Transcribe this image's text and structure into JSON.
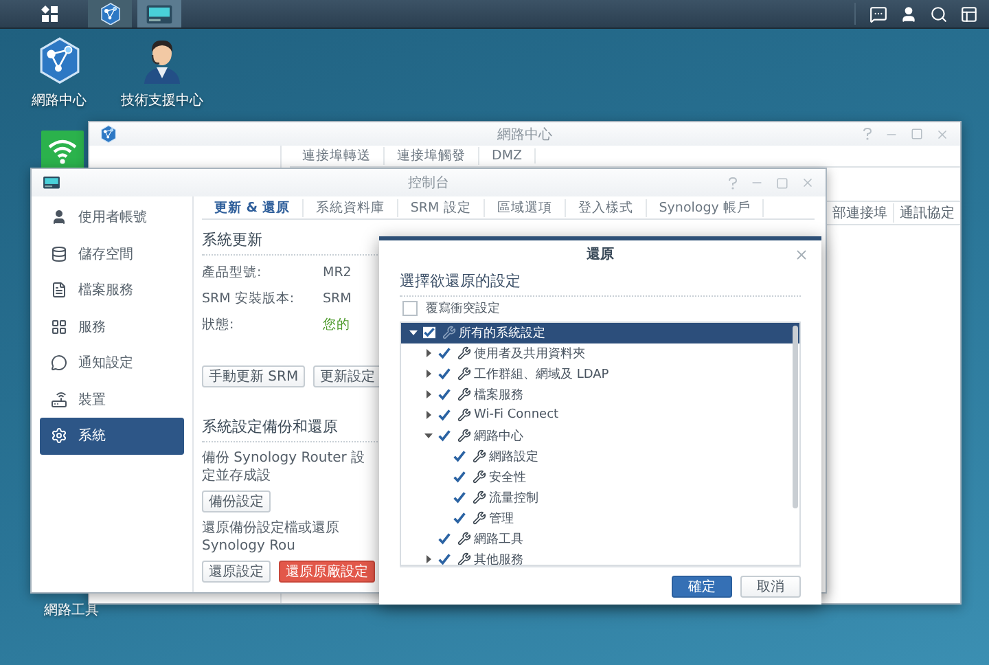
{
  "taskbar": {
    "apps": [
      {
        "kind": "network-center",
        "focused": false
      },
      {
        "kind": "control-panel",
        "focused": true
      }
    ]
  },
  "desktop": {
    "icons": [
      {
        "label": "網路中心",
        "kind": "network"
      },
      {
        "label": "技術支援中心",
        "kind": "support"
      }
    ],
    "bottom_label": "網路工具"
  },
  "network_window": {
    "title": "網路中心",
    "tabs": [
      "連接埠轉送",
      "連接埠觸發",
      "DMZ"
    ],
    "columns": [
      "部連接埠",
      "通訊協定"
    ]
  },
  "control_panel": {
    "title": "控制台",
    "sidebar": [
      {
        "label": "使用者帳號",
        "kind": "user",
        "selected": false
      },
      {
        "label": "儲存空間",
        "kind": "storage",
        "selected": false
      },
      {
        "label": "檔案服務",
        "kind": "file",
        "selected": false
      },
      {
        "label": "服務",
        "kind": "services",
        "selected": false
      },
      {
        "label": "通知設定",
        "kind": "notify",
        "selected": false
      },
      {
        "label": "裝置",
        "kind": "device",
        "selected": false
      },
      {
        "label": "系統",
        "kind": "system",
        "selected": true
      }
    ],
    "tabs": [
      {
        "label": "更新 & 還原",
        "selected": true
      },
      {
        "label": "系統資料庫",
        "selected": false
      },
      {
        "label": "SRM 設定",
        "selected": false
      },
      {
        "label": "區域選項",
        "selected": false
      },
      {
        "label": "登入樣式",
        "selected": false
      },
      {
        "label": "Synology 帳戶",
        "selected": false
      }
    ],
    "update": {
      "heading": "系統更新",
      "rows": [
        {
          "label": "產品型號:",
          "value": "MR2",
          "kind": "plain"
        },
        {
          "label": "SRM 安裝版本:",
          "value": "SRM",
          "kind": "plain"
        },
        {
          "label": "狀態:",
          "value": "您的",
          "kind": "ok"
        }
      ],
      "buttons": [
        "手動更新 SRM",
        "更新設定"
      ]
    },
    "backup": {
      "heading": "系統設定備份和還原",
      "backup_text": "備份 Synology Router 設定並存成設",
      "backup_button": "備份設定",
      "restore_text": "還原備份設定檔或還原 Synology Rou",
      "buttons": [
        {
          "label": "還原設定",
          "kind": "normal"
        },
        {
          "label": "還原原廠設定",
          "kind": "danger"
        }
      ]
    }
  },
  "dialog": {
    "title": "還原",
    "heading": "選擇欲還原的設定",
    "overwrite": {
      "label": "覆寫衝突設定",
      "checked": false
    },
    "tree": [
      {
        "label": "所有的系統設定",
        "checked": true,
        "selected": true,
        "expanded": true,
        "children": [
          {
            "label": "使用者及共用資料夾",
            "checked": true,
            "selected": false,
            "expanded": false
          },
          {
            "label": "工作群組、網域及 LDAP",
            "checked": true,
            "selected": false,
            "expanded": false
          },
          {
            "label": "檔案服務",
            "checked": true,
            "selected": false,
            "expanded": false
          },
          {
            "label": "Wi-Fi Connect",
            "checked": true,
            "selected": false,
            "expanded": false
          },
          {
            "label": "網路中心",
            "checked": true,
            "selected": false,
            "expanded": true,
            "children": [
              {
                "label": "網路設定",
                "checked": true,
                "selected": false
              },
              {
                "label": "安全性",
                "checked": true,
                "selected": false
              },
              {
                "label": "流量控制",
                "checked": true,
                "selected": false
              },
              {
                "label": "管理",
                "checked": true,
                "selected": false
              }
            ]
          },
          {
            "label": "網路工具",
            "checked": true,
            "selected": false
          },
          {
            "label": "其他服務",
            "checked": true,
            "selected": false,
            "expanded": false
          }
        ]
      }
    ],
    "buttons": [
      {
        "label": "確定",
        "kind": "primary"
      },
      {
        "label": "取消",
        "kind": "normal"
      }
    ]
  }
}
